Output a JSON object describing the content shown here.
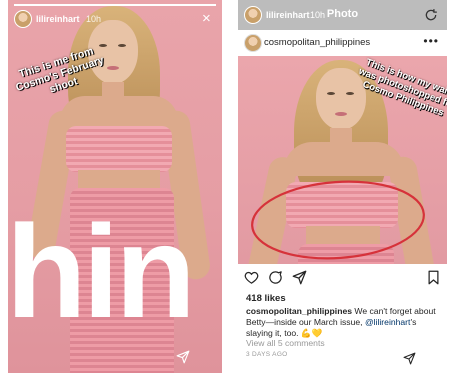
{
  "story": {
    "username": "lilireinhart",
    "time": "10h",
    "close_icon": "×",
    "caption": "This is me from\nCosmo's February\nshoot",
    "big_word": "hin",
    "progress_percent": 100
  },
  "post": {
    "header_title": "Photo",
    "header_username": "lilireinhart",
    "header_time": "10h",
    "username": "cosmopolitan_philippines",
    "overlay_caption": "This is how my waist\nwas photoshopped for\nCosmo Philippines",
    "likes": "418 likes",
    "caption_user": "cosmopolitan_philippines",
    "caption_text_1": " We can't forget about Betty—inside our March issue, ",
    "caption_mention": "@lilireinhart",
    "caption_text_2": "'s slaying it, too. 💪💛",
    "view_all": "View all 5 comments",
    "days_ago": "3 DAYS AGO"
  },
  "colors": {
    "background_pink": "#e59da4",
    "top_pink": "#f2a9b2",
    "highlight_circle": "#d6323a",
    "header_gray": "#bcbcbc"
  },
  "icons": [
    "close-icon",
    "send-icon",
    "more-icon",
    "heart-icon",
    "comment-icon",
    "share-icon",
    "bookmark-icon",
    "refresh-icon"
  ]
}
